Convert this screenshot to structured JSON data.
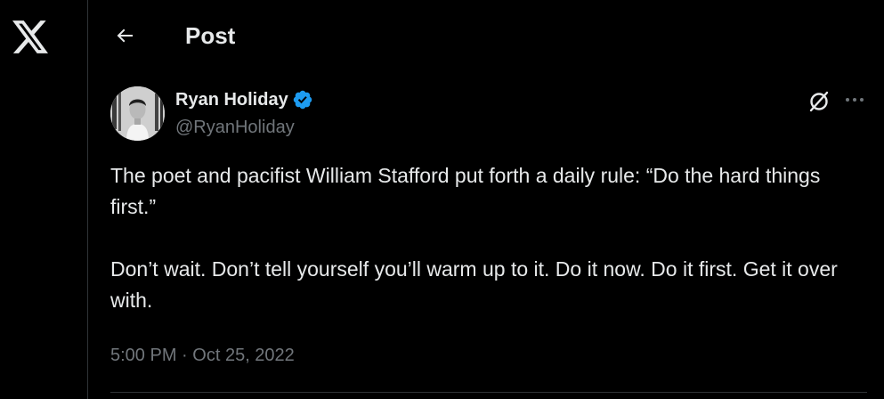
{
  "header": {
    "title": "Post",
    "back_icon": "arrow-left-icon"
  },
  "brand": {
    "logo_icon": "x-logo-icon"
  },
  "post": {
    "author": {
      "name": "Ryan Holiday",
      "handle": "@RyanHoliday",
      "verified": true,
      "verified_color": "#1d9bf0"
    },
    "paragraphs": [
      "The poet and pacifist William Stafford put forth a daily rule: “Do the hard things first.”",
      "Don’t wait. Don’t tell yourself you’ll warm up to it. Do it now. Do it first. Get it over with."
    ],
    "time": "5:00 PM",
    "separator": "·",
    "date": "Oct 25, 2022"
  },
  "actions": {
    "grok_icon": "grok-icon",
    "more_icon": "more-dots-icon"
  },
  "colors": {
    "background": "#000000",
    "text_primary": "#e7e9ea",
    "text_secondary": "#71767b",
    "border": "#2f3336",
    "accent": "#1d9bf0"
  }
}
